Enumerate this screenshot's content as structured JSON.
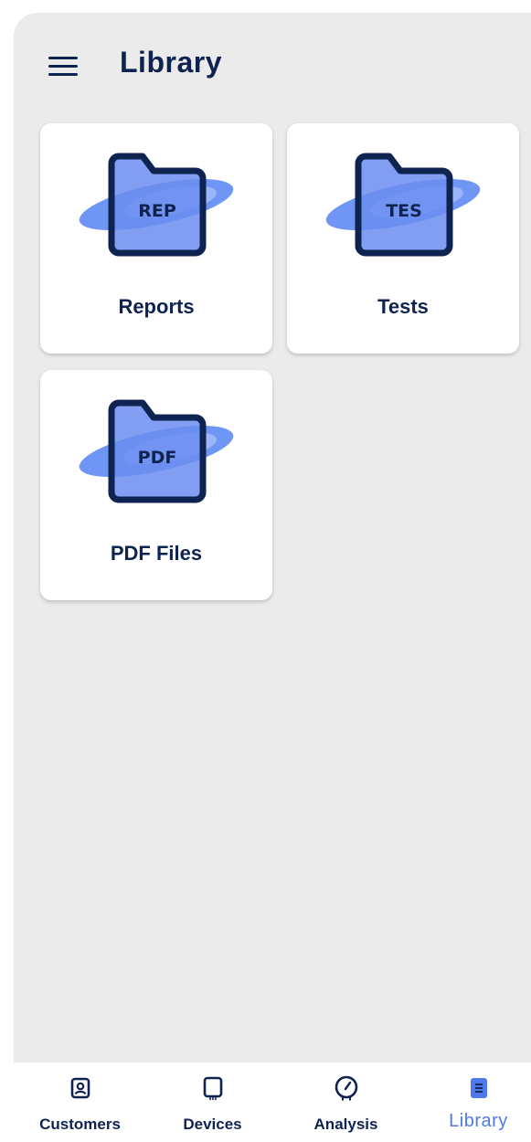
{
  "header": {
    "title": "Library",
    "menu_icon": "hamburger-menu-icon"
  },
  "folders": [
    {
      "label": "Reports",
      "badge": "REP",
      "icon": "folder-icon"
    },
    {
      "label": "Tests",
      "badge": "TES",
      "icon": "folder-icon"
    },
    {
      "label": "PDF Files",
      "badge": "PDF",
      "icon": "folder-icon"
    }
  ],
  "bottom_nav": {
    "items": [
      {
        "label": "Customers",
        "icon": "contact-card-icon",
        "active": false
      },
      {
        "label": "Devices",
        "icon": "device-icon",
        "active": false
      },
      {
        "label": "Analysis",
        "icon": "gauge-icon",
        "active": false
      },
      {
        "label": "Library",
        "icon": "library-book-icon",
        "active": true
      }
    ]
  },
  "colors": {
    "background": "#ebebeb",
    "navy": "#0f2350",
    "accent": "#4f78e8",
    "folder_fill": "#6b8df0",
    "ellipse": "#6f96f5",
    "card": "#ffffff"
  }
}
